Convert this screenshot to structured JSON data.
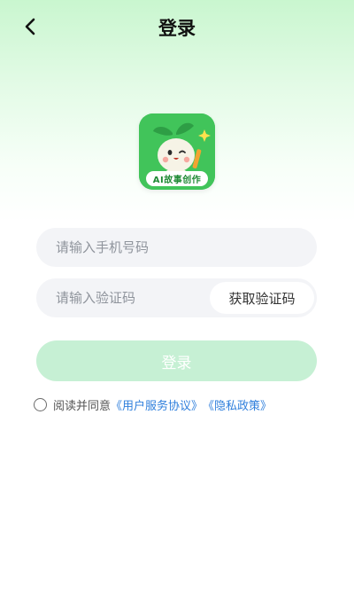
{
  "header": {
    "title": "登录"
  },
  "logo": {
    "label": "AI故事创作"
  },
  "form": {
    "phone_placeholder": "请输入手机号码",
    "code_placeholder": "请输入验证码",
    "get_code_label": "获取验证码",
    "login_label": "登录"
  },
  "agreement": {
    "prefix": "阅读并同意",
    "user_agreement": "《用户服务协议》",
    "privacy_policy": "《隐私政策》"
  },
  "colors": {
    "brand_green": "#41c45a",
    "login_button_disabled": "#c6f0d4",
    "link": "#2f7fdc",
    "field_background": "#f3f4f7"
  }
}
